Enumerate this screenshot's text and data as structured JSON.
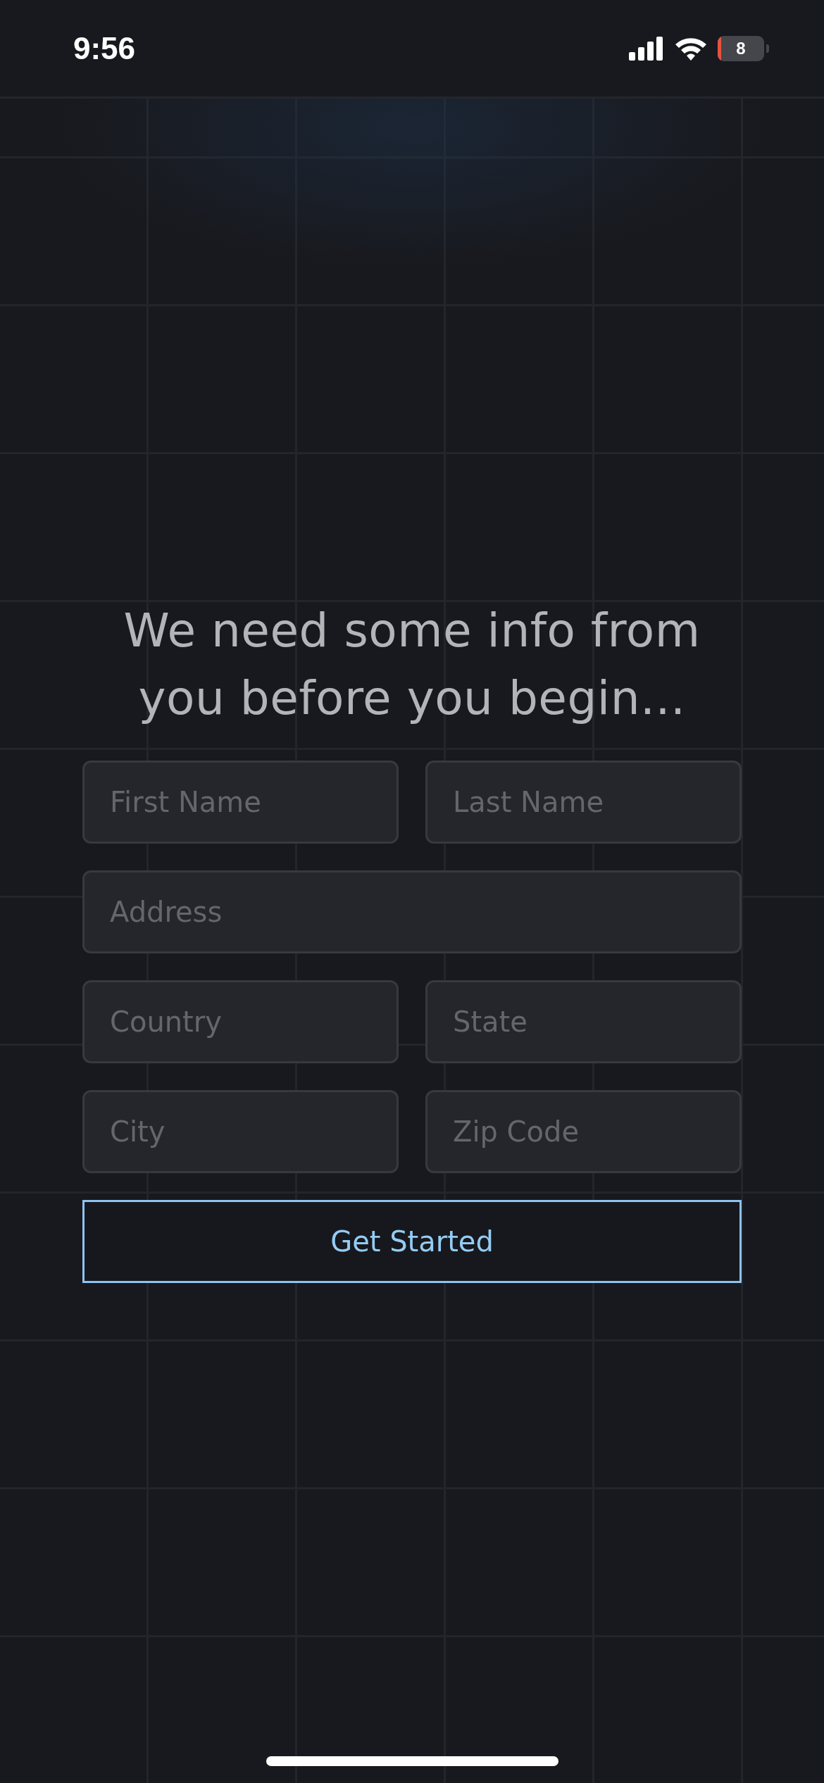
{
  "status_bar": {
    "time": "9:56",
    "battery": "8"
  },
  "heading": "We need some info from you before you begin...",
  "form": {
    "rows": [
      {
        "fields": [
          {
            "placeholder": "First Name"
          },
          {
            "placeholder": "Last Name"
          }
        ]
      },
      {
        "fields": [
          {
            "placeholder": "Address"
          }
        ]
      },
      {
        "fields": [
          {
            "placeholder": "Country"
          },
          {
            "placeholder": "State"
          }
        ]
      },
      {
        "fields": [
          {
            "placeholder": "City"
          },
          {
            "placeholder": "Zip Code"
          }
        ]
      }
    ]
  },
  "button": "Get Started"
}
